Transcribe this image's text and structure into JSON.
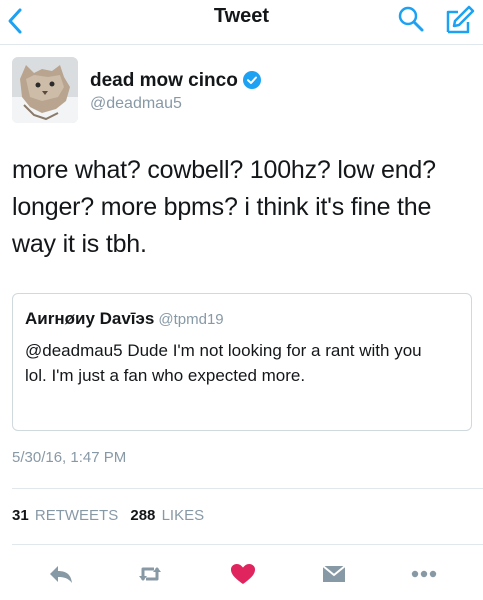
{
  "nav": {
    "title": "Tweet",
    "icons": [
      "back-icon",
      "search-icon",
      "compose-icon"
    ]
  },
  "colors": {
    "accent": "#1da1f2",
    "muted": "#8899a6",
    "like": "#e0245e",
    "verified": "#1da1f2"
  },
  "user": {
    "name": "dead mow cinco",
    "handle": "@deadmau5",
    "verified": true
  },
  "tweet": {
    "text": "more what? cowbell? 100hz? low end? longer? more bpms? i think it's fine the way it is tbh."
  },
  "quote": {
    "name": "Аиrнøиу Davīэs",
    "handle": "@tpmd19",
    "text": "@deadmau5 Dude I'm not looking for a rant with you lol. I'm just a fan who expected more."
  },
  "timestamp": "5/30/16, 1:47 PM",
  "stats": {
    "retweets_count": "31",
    "retweets_label": "RETWEETS",
    "likes_count": "288",
    "likes_label": "LIKES"
  },
  "actions": [
    "reply-icon",
    "retweet-icon",
    "like-icon",
    "message-icon",
    "more-icon"
  ]
}
